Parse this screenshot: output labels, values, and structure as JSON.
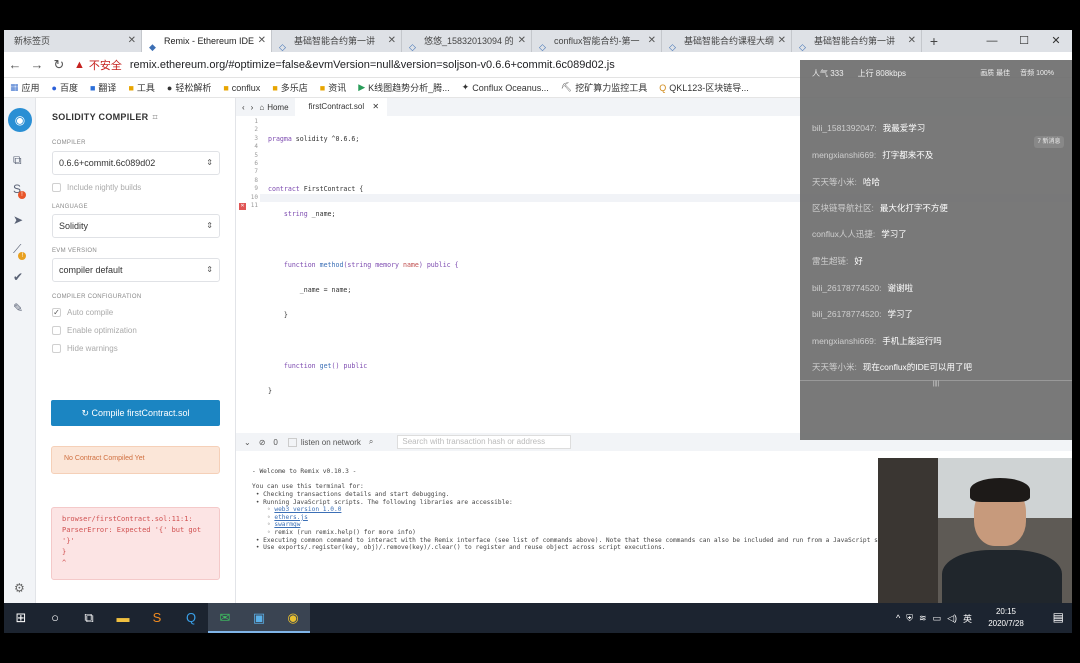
{
  "browser": {
    "tabs": [
      {
        "label": "新标签页"
      },
      {
        "label": "Remix - Ethereum IDE"
      },
      {
        "label": "基础智能合约第一讲"
      },
      {
        "label": "悠悠_15832013094 的"
      },
      {
        "label": "conflux智能合约-第一"
      },
      {
        "label": "基础智能合约课程大纲"
      },
      {
        "label": "基础智能合约第一讲"
      }
    ],
    "new_tab": "+",
    "win_min": "—",
    "win_max": "☐",
    "win_close": "✕",
    "insecure": "不安全",
    "url": "remix.ethereum.org/#optimize=false&evmVersion=null&version=soljson-v0.6.6+commit.6c089d02.js",
    "bookmarks": [
      "应用",
      "百度",
      "翻译",
      "工具",
      "轻松解析",
      "conflux",
      "多乐店",
      "资讯",
      "K线图趋势分析_腾...",
      "Conflux Oceanus...",
      "挖矿算力监控工具",
      "QKL123-区块链导..."
    ]
  },
  "remix": {
    "panel_title": "SOLIDITY COMPILER",
    "compiler_label": "COMPILER",
    "compiler_value": "0.6.6+commit.6c089d02",
    "nightly": "Include nightly builds",
    "language_label": "LANGUAGE",
    "language_value": "Solidity",
    "evm_label": "EVM VERSION",
    "evm_value": "compiler default",
    "config_label": "COMPILER CONFIGURATION",
    "auto_compile": "Auto compile",
    "optimization": "Enable optimization",
    "hide_warnings": "Hide warnings",
    "compile_button": "Compile firstContract.sol",
    "no_contract": "No Contract Compiled Yet",
    "error_lines": [
      "browser/firstContract.sol:11:1:",
      "ParserError: Expected '{' but got",
      "'}'",
      "}",
      "^"
    ],
    "home_tab": "Home",
    "file_tab": "firstContract.sol",
    "line_numbers": [
      "1",
      "2",
      "3",
      "4",
      "5",
      "6",
      "7",
      "8",
      "9",
      "10",
      "11"
    ],
    "code": {
      "l1a": "pragma",
      "l1b": " solidity ",
      "l1c": "^0.6.6;",
      "l3a": "contract",
      "l3b": " FirstContract {",
      "l4a": "    string",
      "l4b": " _name;",
      "l6a": "    function",
      "l6b": " method",
      "l6c": "(string memory ",
      "l6d": "name",
      "l6e": ") public {",
      "l7": "        _name = name;",
      "l8": "    }",
      "l10a": "    function",
      "l10b": " get",
      "l10c": "() public",
      "l11": "}"
    },
    "listen_label": "listen on network",
    "tx_count": "0",
    "search_placeholder": "Search with transaction hash or address",
    "terminal": {
      "t0": "- Welcome to Remix v0.10.3 -",
      "t1": "You can use this terminal for:",
      "t2": " • Checking transactions details and start debugging.",
      "t3": " • Running JavaScript scripts. The following libraries are accessible:",
      "t4": "web3 version 1.0.0",
      "t5": "ethers.js",
      "t6": "swarmgw",
      "t7": "    ◦ remix (run remix.help() for more info)",
      "t8": " • Executing common command to interact with the Remix interface (see list of commands above). Note that these commands can also be included and run from a JavaScript script.",
      "t9": " • Use exports/.register(key, obj)/.remove(key)/.clear() to register and reuse object across script executions."
    }
  },
  "overlay": {
    "popularity": "人气 333",
    "upload": "上行 808kbps",
    "stat1": "画质 最佳",
    "stat2": "音频 100%",
    "hint": "7 新消息",
    "messages": [
      {
        "nick": "bili_1581392047:",
        "text": "我最爱学习"
      },
      {
        "nick": "mengxianshi669:",
        "text": "打字都来不及"
      },
      {
        "nick": "天天等小米:",
        "text": "哈哈"
      },
      {
        "nick": "区块链导航社区:",
        "text": "最大化打字不方便"
      },
      {
        "nick": "conflux人人迅捷:",
        "text": "学习了"
      },
      {
        "nick": "雷生超链:",
        "text": "好"
      },
      {
        "nick": "bili_26178774520:",
        "text": "谢谢啦"
      },
      {
        "nick": "bili_26178774520:",
        "text": "学习了"
      },
      {
        "nick": "mengxianshi669:",
        "text": "手机上能运行吗"
      },
      {
        "nick": "天天等小米:",
        "text": "现在conflux的IDE可以用了吧"
      }
    ],
    "divider": "||||"
  },
  "taskbar": {
    "time": "20:15",
    "date": "2020/7/28",
    "ime": "英"
  }
}
